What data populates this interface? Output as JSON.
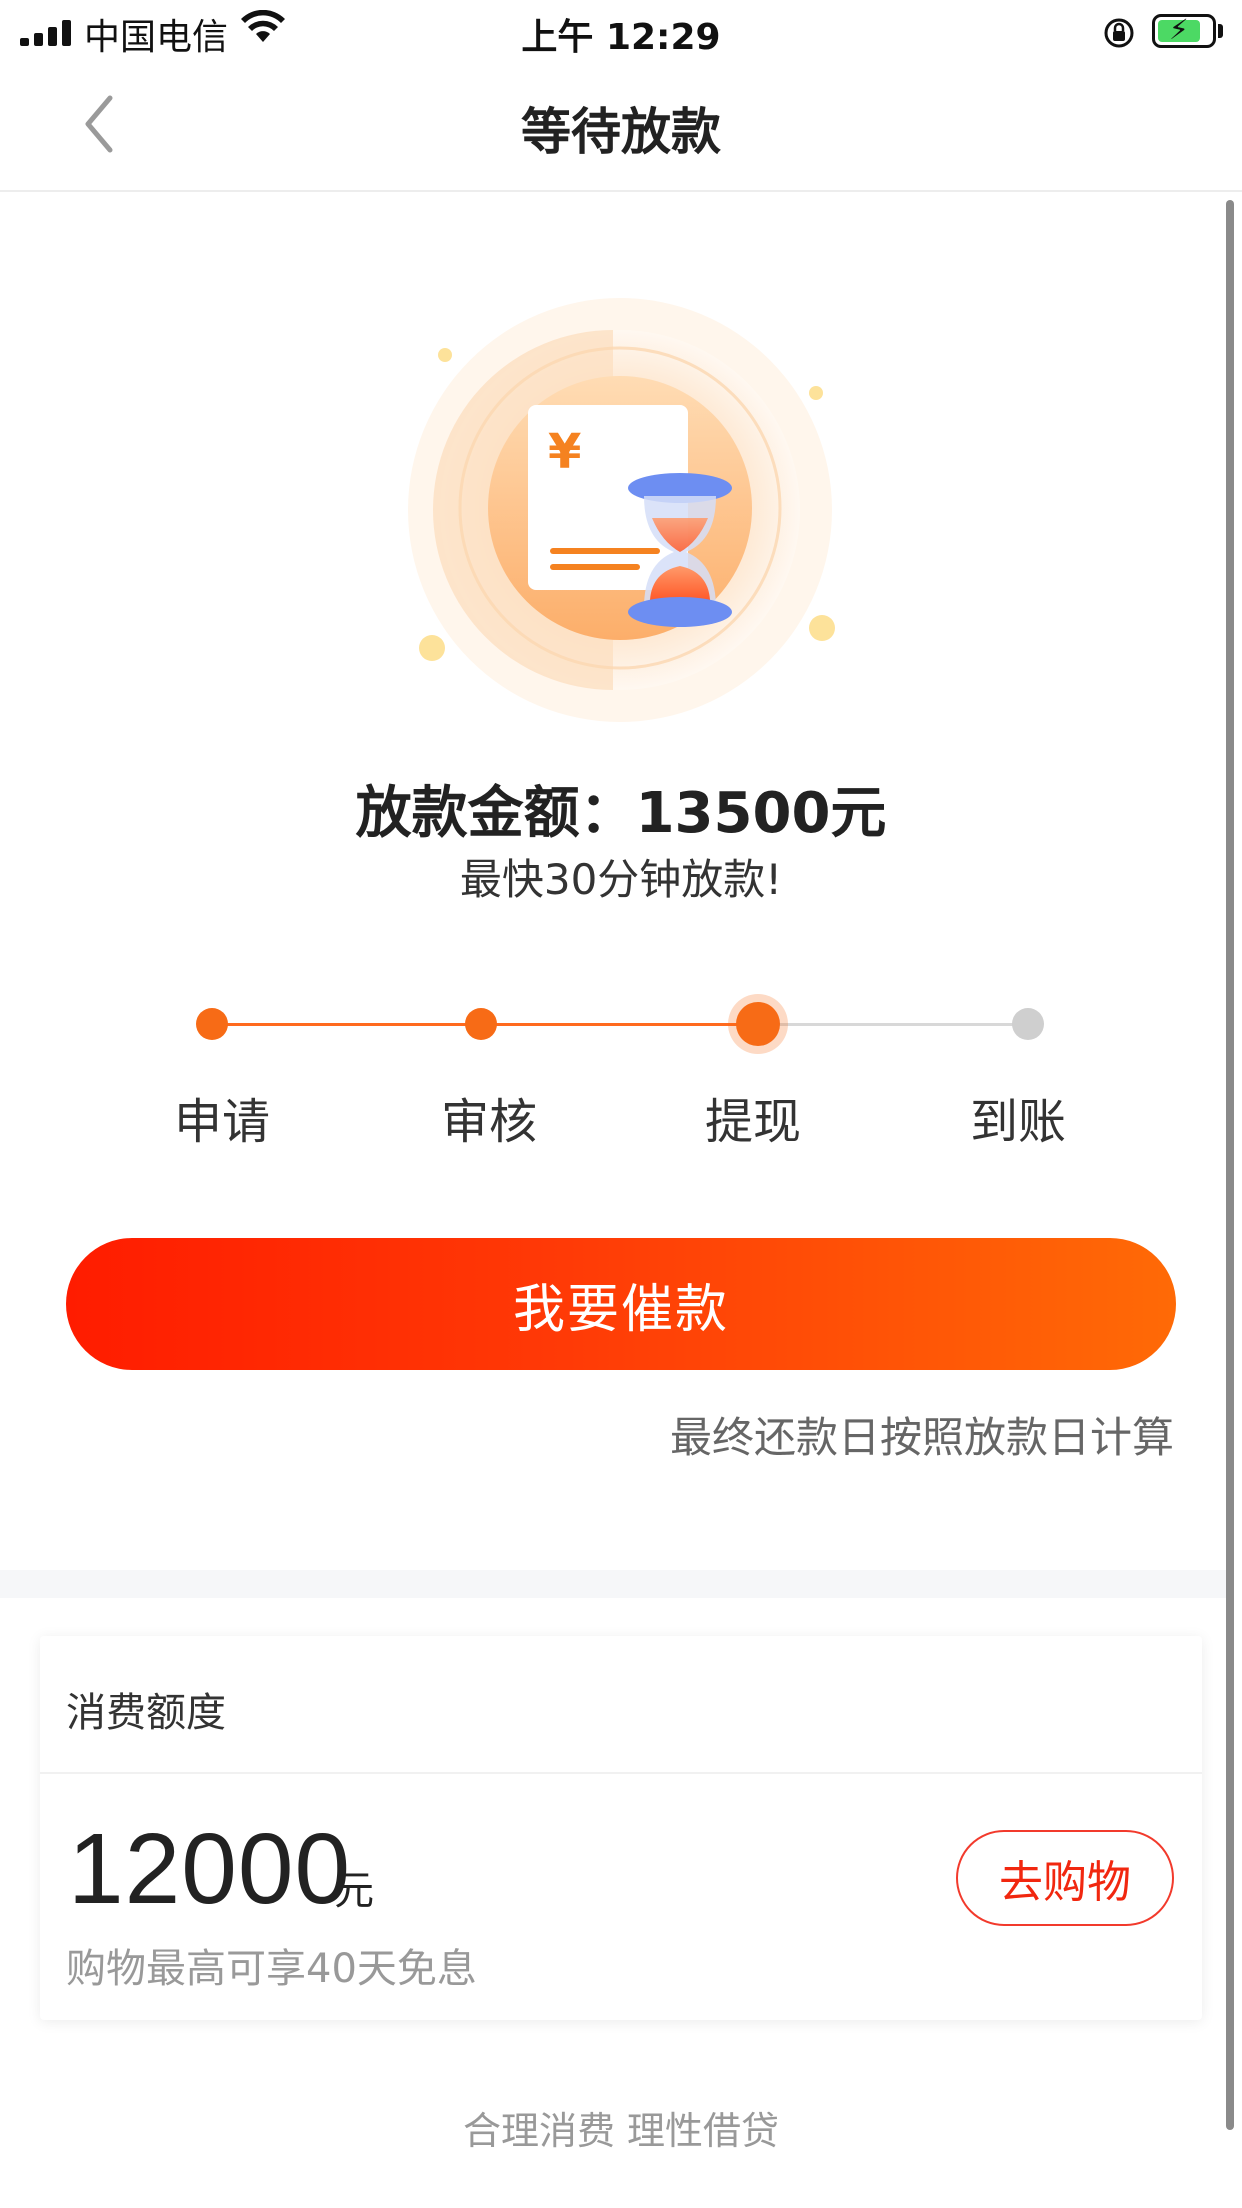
{
  "status_bar": {
    "carrier": "中国电信",
    "time": "上午 12:29"
  },
  "nav": {
    "title": "等待放款",
    "back_icon": "chevron-left-icon"
  },
  "illustration": {
    "currency_symbol": "¥",
    "icon": "hourglass-bill-icon"
  },
  "loan": {
    "amount_text": "放款金额：13500元",
    "subtitle": "最快30分钟放款!"
  },
  "steps": {
    "items": [
      {
        "label": "申请",
        "state": "done"
      },
      {
        "label": "审核",
        "state": "done"
      },
      {
        "label": "提现",
        "state": "current"
      },
      {
        "label": "到账",
        "state": "pending"
      }
    ]
  },
  "actions": {
    "urge_label": "我要催款",
    "note": "最终还款日按照放款日计算"
  },
  "credit_card": {
    "title": "消费额度",
    "amount": "12000",
    "unit": "元",
    "note": "购物最高可享40天免息",
    "shop_label": "去购物"
  },
  "footer": {
    "slogan": "合理消费 理性借贷"
  },
  "colors": {
    "accent": "#f76b16",
    "button_start": "#ff1c00",
    "button_end": "#ff6a06"
  }
}
